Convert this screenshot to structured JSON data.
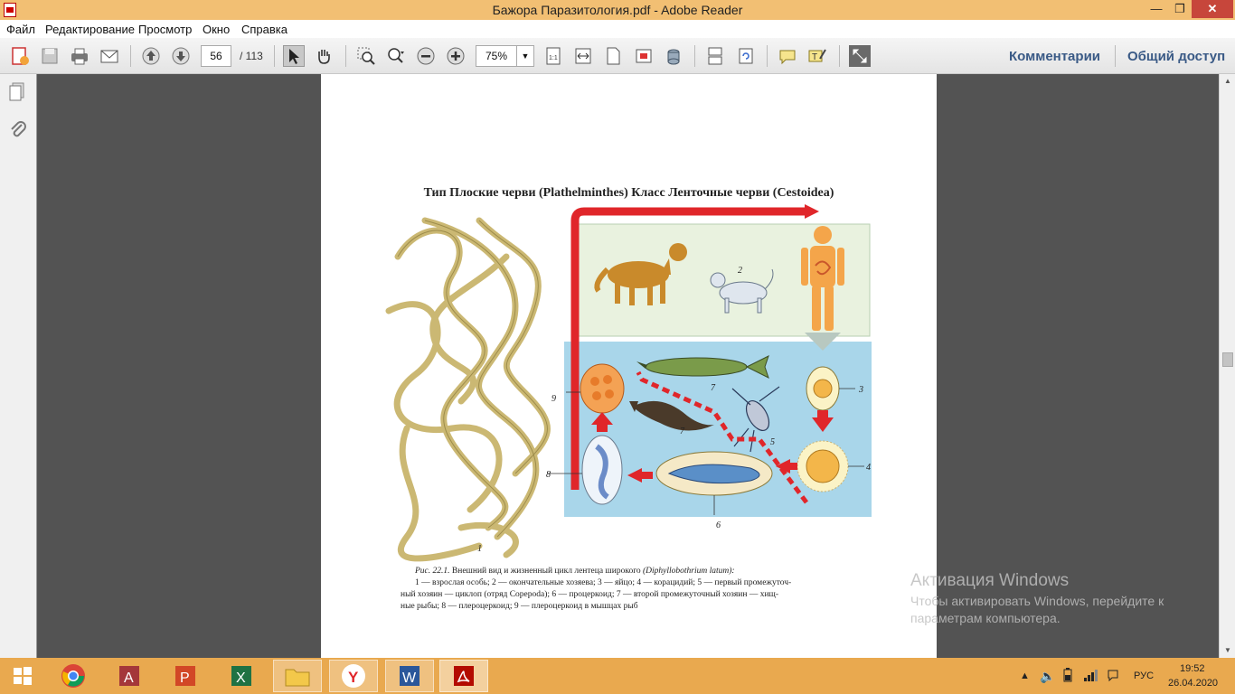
{
  "window": {
    "title": "Бажора Паразитология.pdf - Adobe Reader",
    "minimize_glyph": "—",
    "maximize_glyph": "❐",
    "close_glyph": "✕"
  },
  "menu": {
    "items": [
      "Файл",
      "Редактирование",
      "Просмотр",
      "Окно",
      "Справка"
    ]
  },
  "toolbar": {
    "page_current": "56",
    "page_total": "/ 113",
    "zoom": "75%",
    "comments_label": "Комментарии",
    "share_label": "Общий доступ"
  },
  "document": {
    "heading": "Тип Плоские черви (Plathelminthes) Класс Ленточные черви (Cestoidea)",
    "figure_labels": {
      "l1": "1",
      "l2": "2",
      "l3": "3",
      "l4": "4",
      "l5": "5",
      "l6": "6",
      "l7a": "7",
      "l7b": "7",
      "l8": "8",
      "l9": "9"
    },
    "caption": {
      "fig_ref": "Рис. 22.1.",
      "title": " Внешний вид и жизненный цикл лентеца широкого ",
      "latin": "(Diphyllobothrium latum):",
      "line2": "1 — взрослая особь; 2 — окончательные хозяева; 3 — яйцо; 4 — корацидий; 5 — первый промежуточ-",
      "line3": "ный хозяин — циклоп (отряд Copepoda); 6 — процеркоид; 7 — второй промежуточный хозяин — хищ-",
      "line4": "ные рыбы; 8 — плероцеркоид; 9 — плероцеркоид в мышцах рыб"
    }
  },
  "watermark": {
    "title": "Активация Windows",
    "line1": "Чтобы активировать Windows, перейдите к",
    "line2": "параметрам компьютера."
  },
  "taskbar": {
    "language": "РУС",
    "time": "19:52",
    "date": "26.04.2020"
  },
  "colors": {
    "titlebar": "#f2bf73",
    "taskbar": "#e9a94f",
    "viewer_bg": "#535353",
    "close_button": "#c7463b",
    "link_text": "#3a5a86",
    "cycle_arrow": "#e0262a",
    "water": "#a9d6ea"
  }
}
